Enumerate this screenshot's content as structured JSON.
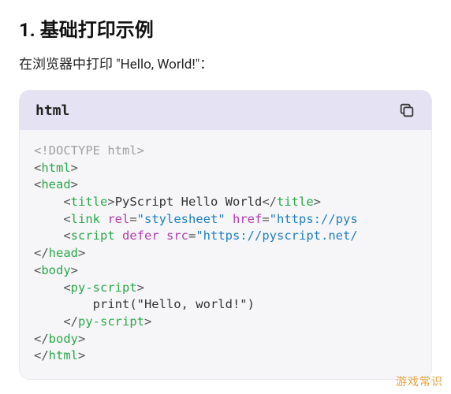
{
  "heading": "1. 基础打印示例",
  "intro": "在浏览器中打印 \"Hello, World!\"：",
  "code": {
    "language": "html",
    "tokens": [
      [
        {
          "t": "<!DOCTYPE html>",
          "c": "tok-doctype"
        }
      ],
      [
        {
          "t": "<",
          "c": "tok-bracket"
        },
        {
          "t": "html",
          "c": "tok-tag"
        },
        {
          "t": ">",
          "c": "tok-bracket"
        }
      ],
      [
        {
          "t": "<",
          "c": "tok-bracket"
        },
        {
          "t": "head",
          "c": "tok-tag"
        },
        {
          "t": ">",
          "c": "tok-bracket"
        }
      ],
      [
        {
          "t": "    <",
          "c": "tok-bracket"
        },
        {
          "t": "title",
          "c": "tok-tag"
        },
        {
          "t": ">",
          "c": "tok-bracket"
        },
        {
          "t": "PyScript Hello World",
          "c": "tok-plain"
        },
        {
          "t": "</",
          "c": "tok-bracket"
        },
        {
          "t": "title",
          "c": "tok-tag"
        },
        {
          "t": ">",
          "c": "tok-bracket"
        }
      ],
      [
        {
          "t": "    <",
          "c": "tok-bracket"
        },
        {
          "t": "link",
          "c": "tok-tag"
        },
        {
          "t": " rel",
          "c": "tok-attr"
        },
        {
          "t": "=",
          "c": "tok-bracket"
        },
        {
          "t": "\"stylesheet\"",
          "c": "tok-string"
        },
        {
          "t": " href",
          "c": "tok-attr"
        },
        {
          "t": "=",
          "c": "tok-bracket"
        },
        {
          "t": "\"https://pys",
          "c": "tok-string"
        }
      ],
      [
        {
          "t": "    <",
          "c": "tok-bracket"
        },
        {
          "t": "script",
          "c": "tok-tag"
        },
        {
          "t": " defer src",
          "c": "tok-attr"
        },
        {
          "t": "=",
          "c": "tok-bracket"
        },
        {
          "t": "\"https://pyscript.net/",
          "c": "tok-string"
        }
      ],
      [
        {
          "t": "</",
          "c": "tok-bracket"
        },
        {
          "t": "head",
          "c": "tok-tag"
        },
        {
          "t": ">",
          "c": "tok-bracket"
        }
      ],
      [
        {
          "t": "<",
          "c": "tok-bracket"
        },
        {
          "t": "body",
          "c": "tok-tag"
        },
        {
          "t": ">",
          "c": "tok-bracket"
        }
      ],
      [
        {
          "t": "    <",
          "c": "tok-bracket"
        },
        {
          "t": "py-script",
          "c": "tok-tag"
        },
        {
          "t": ">",
          "c": "tok-bracket"
        }
      ],
      [
        {
          "t": "        print(\"Hello, world!\")",
          "c": "tok-plain"
        }
      ],
      [
        {
          "t": "    </",
          "c": "tok-bracket"
        },
        {
          "t": "py-script",
          "c": "tok-tag"
        },
        {
          "t": ">",
          "c": "tok-bracket"
        }
      ],
      [
        {
          "t": "</",
          "c": "tok-bracket"
        },
        {
          "t": "body",
          "c": "tok-tag"
        },
        {
          "t": ">",
          "c": "tok-bracket"
        }
      ],
      [
        {
          "t": "</",
          "c": "tok-bracket"
        },
        {
          "t": "html",
          "c": "tok-tag"
        },
        {
          "t": ">",
          "c": "tok-bracket"
        }
      ]
    ]
  },
  "watermark": "游戏常识"
}
